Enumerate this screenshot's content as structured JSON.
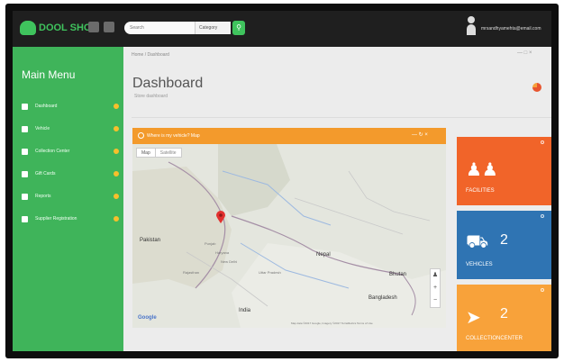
{
  "brand": {
    "name": "DOOL SHOP"
  },
  "topbar": {
    "search_placeholder": "Search",
    "category_select": "Category",
    "user_email": "mrsandhyamehta@email.com"
  },
  "sidebar": {
    "title": "Main Menu",
    "items": [
      {
        "label": "Dashboard",
        "icon": "home-icon"
      },
      {
        "label": "Vehicle",
        "icon": "car-icon"
      },
      {
        "label": "Collection Center",
        "icon": "map-icon"
      },
      {
        "label": "Gift Cards",
        "icon": "card-icon"
      },
      {
        "label": "Reports",
        "icon": "chart-icon"
      },
      {
        "label": "Supplier Registration",
        "icon": "user-plus-icon"
      }
    ]
  },
  "content": {
    "breadcrumb": "Home / Dashboard",
    "title": "Dashboard",
    "subtitle": "Store dashboard"
  },
  "map": {
    "header": "Where is my vehicle? Map",
    "type_options": [
      "Map",
      "Satellite"
    ],
    "labels": {
      "pakistan": "Pakistan",
      "nepal": "Nepal",
      "bhutan": "Bhutan",
      "bangladesh": "Bangladesh",
      "india": "India",
      "new_delhi": "New Delhi",
      "uttar_pradesh": "Uttar Pradesh",
      "punjab": "Punjab",
      "rajasthan": "Rajasthan",
      "haryana": "Haryana"
    },
    "google_logo": "Google",
    "attribution": "Map data ©2017 Google, Imagery ©2017 TerraMetrics   Terms of Use",
    "zoom_in": "+",
    "zoom_out": "−"
  },
  "tiles": [
    {
      "label": "FACILITIES",
      "value": "",
      "icon": "users-icon",
      "color": "#f16429"
    },
    {
      "label": "VEHICLES",
      "value": "2",
      "icon": "truck-icon",
      "color": "#2f74b3"
    },
    {
      "label": "COLLECTIONCENTER",
      "value": "2",
      "icon": "paper-plane-icon",
      "color": "#f8a23a"
    }
  ],
  "colors": {
    "sidebar": "#3fb45a",
    "topbar": "#1f1f1f",
    "accent": "#f39a2c"
  }
}
